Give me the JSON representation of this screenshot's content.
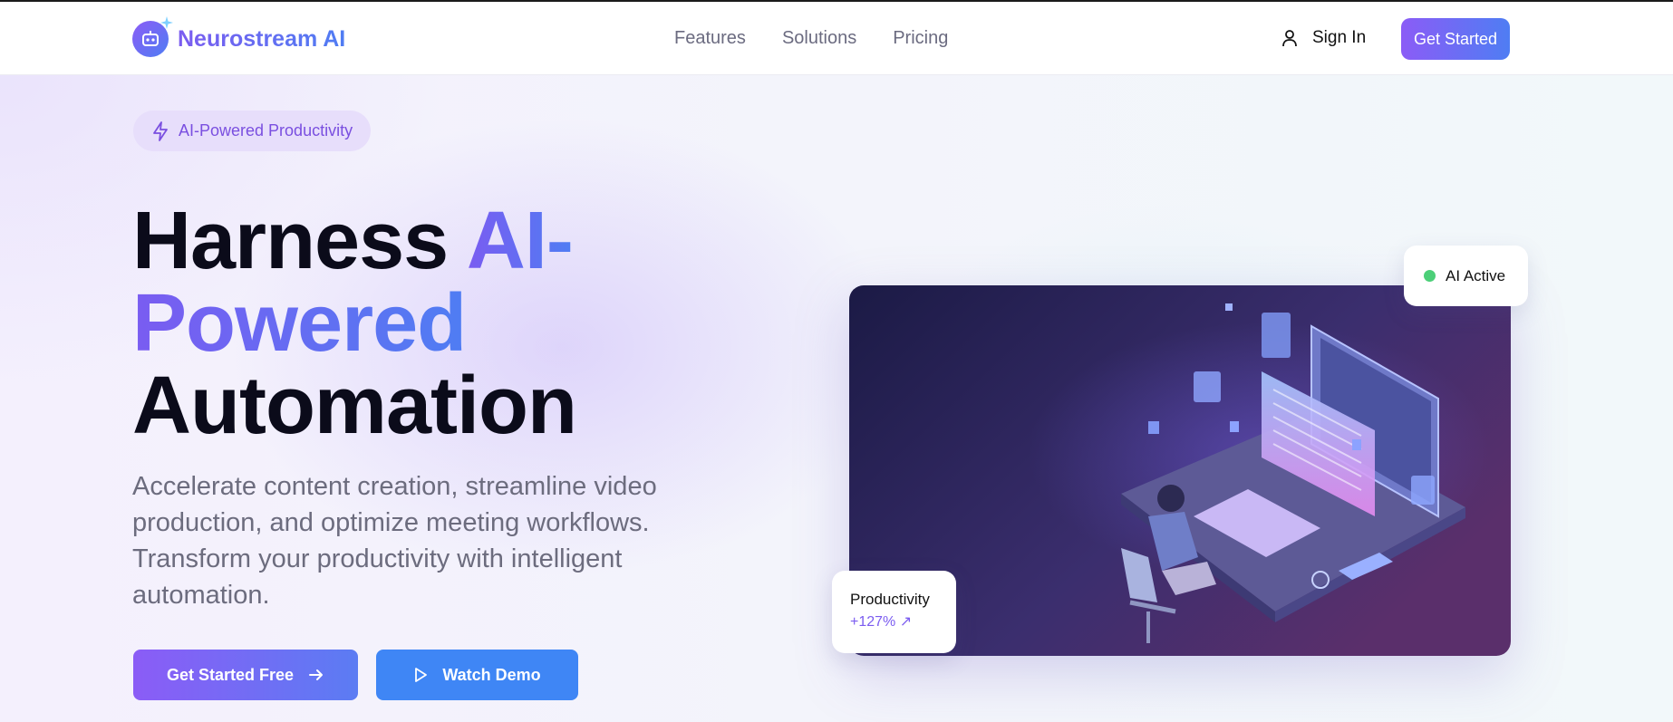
{
  "brand": {
    "name": "Neurostream AI"
  },
  "nav": {
    "links": [
      "Features",
      "Solutions",
      "Pricing"
    ],
    "sign_in": "Sign In",
    "cta": "Get Started"
  },
  "hero": {
    "badge": "AI-Powered Productivity",
    "headline": {
      "line1": "Harness ",
      "line1_accent": "AI-",
      "line2_accent": "Powered",
      "line3": "Automation"
    },
    "subtitle": "Accelerate content creation, streamline video production, and optimize meeting workflows. Transform your productivity with intelligent automation.",
    "primary_button": "Get Started Free",
    "secondary_button": "Watch Demo"
  },
  "status_card": {
    "label": "AI Active",
    "color": "#4ccf78"
  },
  "productivity_card": {
    "label": "Productivity",
    "value": "+127% ↗"
  },
  "colors": {
    "accent_purple": "#8b5cf6",
    "accent_blue": "#4f7df3",
    "demo_blue": "#3f86f5"
  },
  "icons": {
    "logo": "robot-icon",
    "badge": "lightning-icon",
    "sign_in": "user-icon",
    "primary": "arrow-right-icon",
    "demo": "play-icon"
  }
}
